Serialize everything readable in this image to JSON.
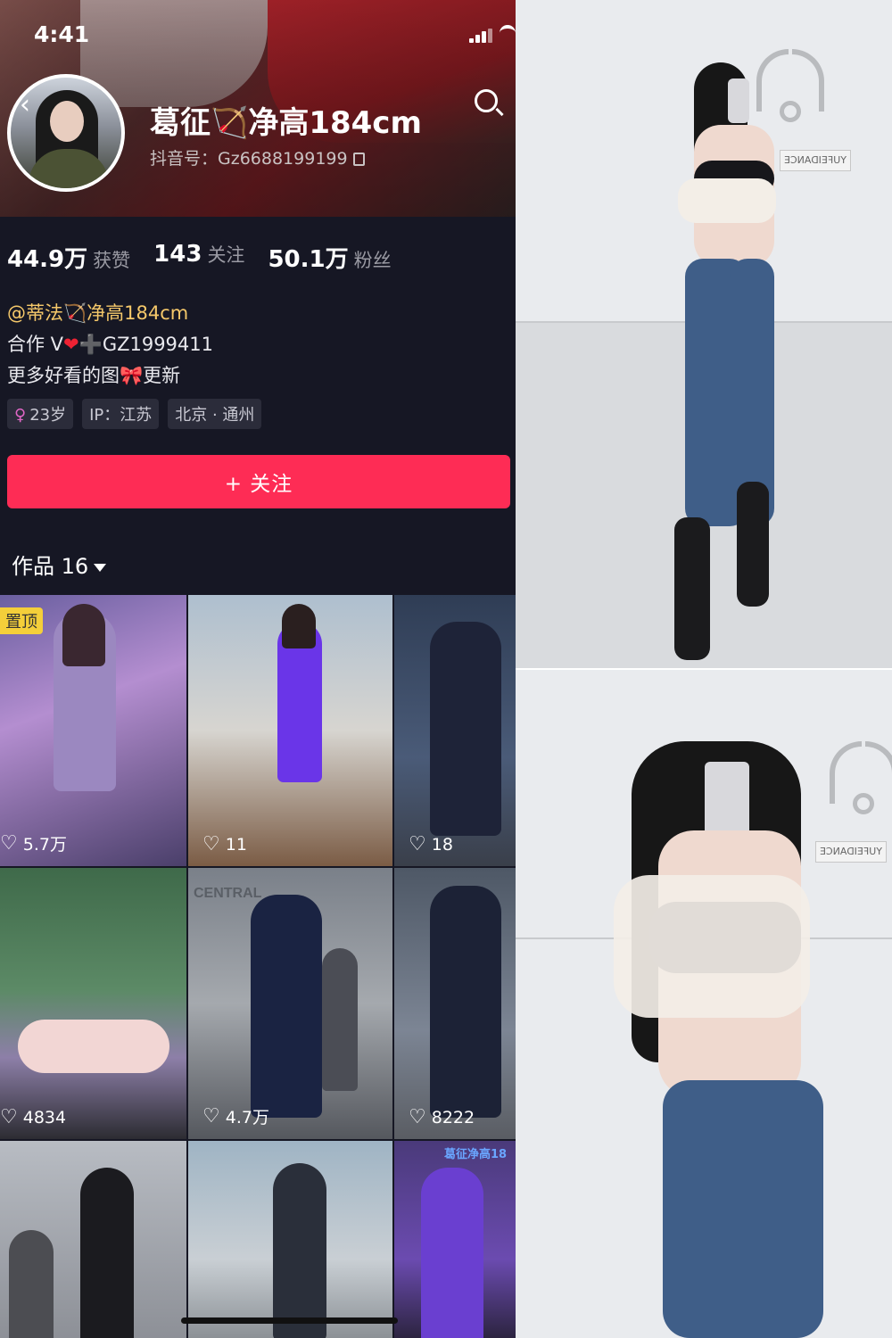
{
  "status_bar": {
    "time": "4:41"
  },
  "profile": {
    "name": "葛征🏹净高184cm",
    "douyin_id": "抖音号：Gz6688199199"
  },
  "stats": [
    {
      "value": "44.9万",
      "label": "获赞"
    },
    {
      "value": "143",
      "label": "关注"
    },
    {
      "value": "50.1万",
      "label": "粉丝"
    }
  ],
  "bio": {
    "line1": "@蒂法🏹净高184cm",
    "line2_prefix": "合作 V",
    "line2_suffix": "GZ1999411",
    "line3_prefix": "更多好看的图",
    "line3_suffix": "更新"
  },
  "tags": {
    "age": "23岁",
    "ip": "IP：江苏",
    "location": "北京 · 通州"
  },
  "follow_button": "+ 关注",
  "works_tab": "作品 16",
  "videos": [
    {
      "likes": "5.7万",
      "pinned": "置顶"
    },
    {
      "likes": "11"
    },
    {
      "likes": "18"
    },
    {
      "likes": "4834"
    },
    {
      "likes": "4.7万",
      "sign": "CENTRAL"
    },
    {
      "likes": "8222"
    },
    {
      "likes": ""
    },
    {
      "likes": ""
    },
    {
      "likes": "",
      "banner": "葛征净高18"
    }
  ],
  "photos": {
    "top_sign": "YUFEIDANCE",
    "bottom_sign": "YUFEIDANCE"
  },
  "colors": {
    "background": "#161724",
    "follow_button": "#fe2c55",
    "mention": "#f5c86a",
    "tag_bg": "#2b2c3a"
  }
}
